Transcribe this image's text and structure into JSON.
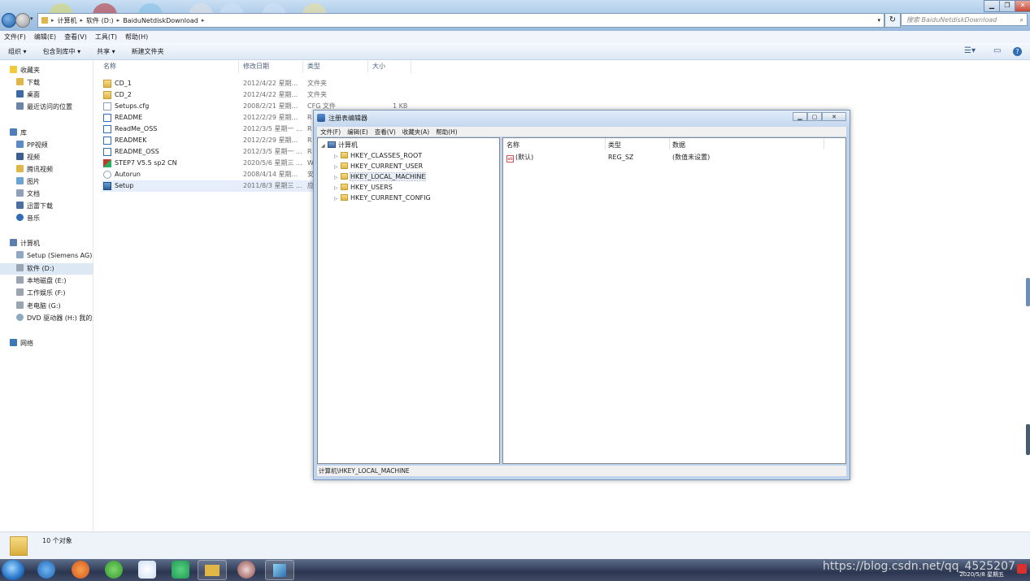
{
  "explorer": {
    "address": [
      "计算机",
      "软件 (D:)",
      "BaiduNetdiskDownload"
    ],
    "search_placeholder": "搜索 BaiduNetdiskDownload",
    "menu": [
      "文件(F)",
      "编辑(E)",
      "查看(V)",
      "工具(T)",
      "帮助(H)"
    ],
    "commands": [
      "组织 ▾",
      "包含到库中 ▾",
      "共享 ▾",
      "新建文件夹"
    ],
    "columns": [
      "名称",
      "修改日期",
      "类型",
      "大小"
    ],
    "nav": {
      "favorites_header": "收藏夹",
      "favorites": [
        "下载",
        "桌面",
        "最近访问的位置"
      ],
      "libraries_header": "库",
      "libraries": [
        "PP视频",
        "视频",
        "腾讯视频",
        "图片",
        "文档",
        "迅雷下载",
        "音乐"
      ],
      "computer_header": "计算机",
      "computer": [
        "Setup (Siemens AG) (",
        "软件 (D:)",
        "本地磁盘 (E:)",
        "工作娱乐 (F:)",
        "老电脑 (G:)",
        "DVD 驱动器 (H:) 我的光"
      ],
      "network": "网络"
    },
    "files": [
      {
        "name": "CD_1",
        "date": "2012/4/22 星期...",
        "type": "文件夹",
        "size": "",
        "icon": "folder"
      },
      {
        "name": "CD_2",
        "date": "2012/4/22 星期...",
        "type": "文件夹",
        "size": "",
        "icon": "folder"
      },
      {
        "name": "Setups.cfg",
        "date": "2008/2/21 星期...",
        "type": "CFG 文件",
        "size": "1 KB",
        "icon": "doc"
      },
      {
        "name": "README",
        "date": "2012/2/29 星期...",
        "type": "R",
        "size": "",
        "icon": "doc"
      },
      {
        "name": "ReadMe_OSS",
        "date": "2012/3/5 星期一 ...",
        "type": "R",
        "size": "",
        "icon": "doc"
      },
      {
        "name": "READMEK",
        "date": "2012/2/29 星期...",
        "type": "R",
        "size": "",
        "icon": "doc"
      },
      {
        "name": "README_OSS",
        "date": "2012/3/5 星期一 ...",
        "type": "R",
        "size": "",
        "icon": "doc"
      },
      {
        "name": "STEP7 V5.5 sp2 CN",
        "date": "2020/5/6 星期三 ...",
        "type": "W",
        "size": "",
        "icon": "app"
      },
      {
        "name": "Autorun",
        "date": "2008/4/14 星期...",
        "type": "安",
        "size": "",
        "icon": "doc"
      },
      {
        "name": "Setup",
        "date": "2011/8/3 星期三 ...",
        "type": "应",
        "size": "",
        "icon": "app"
      }
    ],
    "status_count": "10 个对象"
  },
  "regedit": {
    "title": "注册表编辑器",
    "menu": [
      "文件(F)",
      "编辑(E)",
      "查看(V)",
      "收藏夹(A)",
      "帮助(H)"
    ],
    "tree_root": "计算机",
    "tree_items": [
      "HKEY_CLASSES_ROOT",
      "HKEY_CURRENT_USER",
      "HKEY_LOCAL_MACHINE",
      "HKEY_USERS",
      "HKEY_CURRENT_CONFIG"
    ],
    "value_columns": [
      "名称",
      "类型",
      "数据"
    ],
    "value_row": {
      "name": "(默认)",
      "type": "REG_SZ",
      "data": "(数值未设置)"
    },
    "status": "计算机\\HKEY_LOCAL_MACHINE"
  },
  "taskbar": {
    "watermark": "https://blog.csdn.net/qq_4525207",
    "date": "2020/5/8 星期五"
  }
}
